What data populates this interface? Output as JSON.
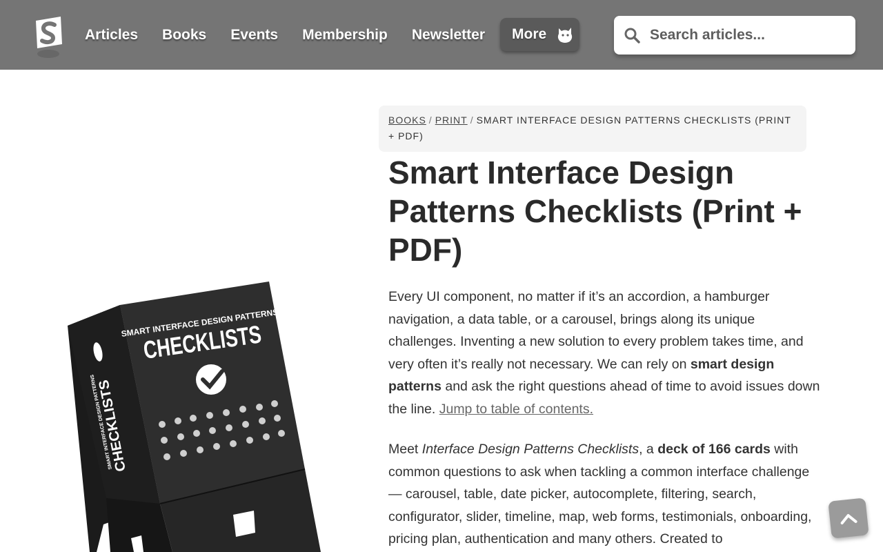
{
  "header": {
    "logo_alt": "S",
    "nav": [
      {
        "label": "Articles"
      },
      {
        "label": "Books"
      },
      {
        "label": "Events"
      },
      {
        "label": "Membership"
      },
      {
        "label": "Newsletter"
      }
    ],
    "more_label": "More",
    "search_placeholder": "Search articles..."
  },
  "breadcrumb": {
    "items": [
      {
        "label": "BOOKS"
      },
      {
        "label": "PRINT"
      }
    ],
    "current": "SMART INTERFACE DESIGN PATTERNS CHECKLISTS (PRINT + PDF)",
    "separator": "/"
  },
  "product": {
    "title": "Smart Interface Design Patterns Checklists (Print + PDF)",
    "box_text_top": "SMART INTERFACE DESIGN PATTERNS",
    "box_text_main": "CHECKLISTS",
    "box_side_small": "SMART INTERFACE DESIGN PATTERNS",
    "box_side_main": "CHECKLISTS"
  },
  "description": {
    "p1": {
      "text_a": "Every UI component, no matter if it’s an accordion, a hamburger navigation, a data table, or a carousel, brings along its unique challenges. Inventing a new solution to every problem takes time, and very often it’s really not necessary. We can rely on ",
      "bold": "smart design patterns",
      "text_b": " and ask the right questions ahead of time to avoid issues down the line. ",
      "link": "Jump to table of contents."
    },
    "p2": {
      "text_a": "Meet ",
      "italic": "Interface Design Patterns Checklists",
      "text_b": ", a ",
      "bold": "deck of 166 cards",
      "text_c": " with common questions to ask when tackling a common interface challenge — carousel, table, date picker, autocomplete, filtering, search, configurator, slider, timeline, map, web forms, testimonials, onboarding, pricing plan, authentication and many others. Created to"
    }
  },
  "icons": {
    "search": "search-icon",
    "more": "cat-icon",
    "to_top": "chevron-up-icon",
    "logo": "smashing-logo-icon"
  }
}
